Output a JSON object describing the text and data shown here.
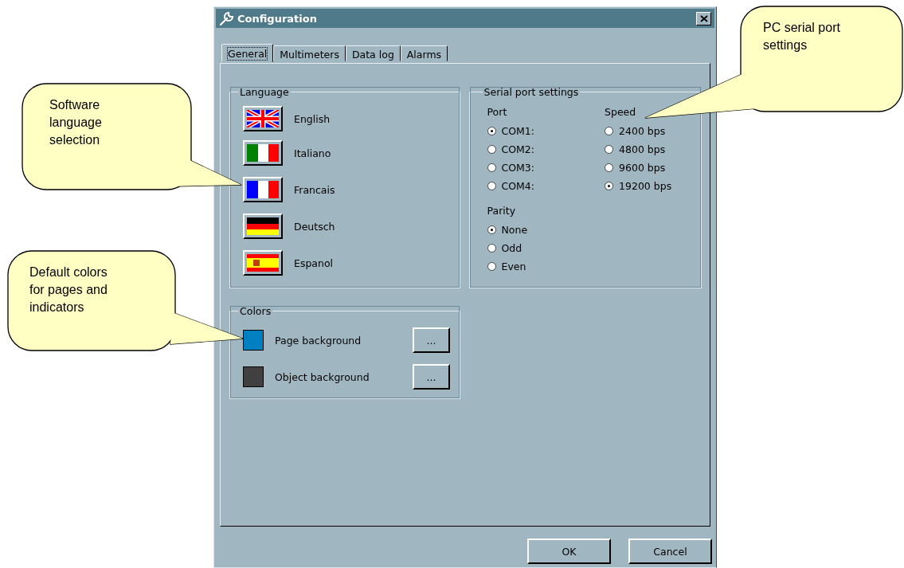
{
  "window": {
    "title": "Configuration"
  },
  "tabs": [
    {
      "label": "General",
      "selected": true
    },
    {
      "label": "Multimeters",
      "selected": false
    },
    {
      "label": "Data log",
      "selected": false
    },
    {
      "label": "Alarms",
      "selected": false
    }
  ],
  "language": {
    "title": "Language",
    "items": [
      {
        "label": "English",
        "kind": "uk"
      },
      {
        "label": "Italiano",
        "kind": "it"
      },
      {
        "label": "Francais",
        "kind": "fr"
      },
      {
        "label": "Deutsch",
        "kind": "de"
      },
      {
        "label": "Espanol",
        "kind": "es"
      }
    ]
  },
  "serial": {
    "title": "Serial port settings",
    "port": {
      "label": "Port",
      "options": [
        {
          "label": "COM1:",
          "selected": true
        },
        {
          "label": "COM2:",
          "selected": false
        },
        {
          "label": "COM3:",
          "selected": false
        },
        {
          "label": "COM4:",
          "selected": false
        }
      ]
    },
    "speed": {
      "label": "Speed",
      "options": [
        {
          "label": "2400 bps",
          "selected": false
        },
        {
          "label": "4800 bps",
          "selected": false
        },
        {
          "label": "9600 bps",
          "selected": false
        },
        {
          "label": "19200 bps",
          "selected": true
        }
      ]
    },
    "parity": {
      "label": "Parity",
      "options": [
        {
          "label": "None",
          "selected": true
        },
        {
          "label": "Odd",
          "selected": false
        },
        {
          "label": "Even",
          "selected": false
        }
      ]
    }
  },
  "colors": {
    "title": "Colors",
    "items": [
      {
        "label": "Page background",
        "color": "#0080c0",
        "button": "..."
      },
      {
        "label": "Object background",
        "color": "#404040",
        "button": "..."
      }
    ]
  },
  "buttons": [
    "OK",
    "Cancel"
  ],
  "callouts": [
    "Software language selection",
    "Default colors for pages and indicators",
    "PC serial port settings"
  ]
}
